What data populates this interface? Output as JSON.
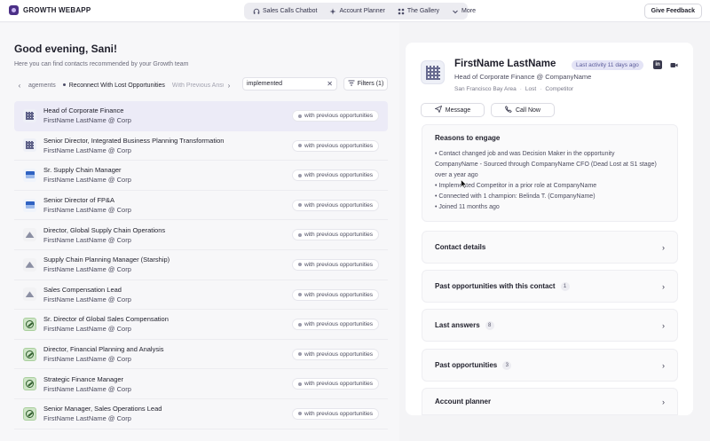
{
  "app": {
    "brand": "GROWTH WEBAPP"
  },
  "nav": {
    "items": [
      {
        "label": "Sales Calls Chatbot",
        "icon": "headset-icon"
      },
      {
        "label": "Account Planner",
        "icon": "sparkle-icon"
      },
      {
        "label": "The Gallery",
        "icon": "gallery-icon"
      },
      {
        "label": "More",
        "icon": "chevron-down-icon"
      }
    ],
    "feedback_label": "Give Feedback"
  },
  "left": {
    "greeting": "Good evening, Sani!",
    "subtitle": "Here you can find contacts recommended by your Growth team",
    "chips": [
      {
        "label": "agements"
      },
      {
        "label": "Reconnect With Lost Opportunities"
      },
      {
        "label": "With Previous Answ"
      }
    ],
    "search": {
      "value": "implemented"
    },
    "filters_label": "Filters (1)",
    "contacts": [
      {
        "title": "Head of Corporate Finance",
        "company": "FirstName LastName @ Corp",
        "tag": "with previous opportunities",
        "logo": "grid"
      },
      {
        "title": "Senior Director, Integrated Business Planning Transformation",
        "company": "FirstName LastName @ Corp",
        "tag": "with previous opportunities",
        "logo": "grid"
      },
      {
        "title": "Sr. Supply Chain Manager",
        "company": "FirstName LastName @ Corp",
        "tag": "with previous opportunities",
        "logo": "blue"
      },
      {
        "title": "Senior Director of FP&A",
        "company": "FirstName LastName @ Corp",
        "tag": "with previous opportunities",
        "logo": "blue"
      },
      {
        "title": "Director, Global Supply Chain Operations",
        "company": "FirstName LastName @ Corp",
        "tag": "with previous opportunities",
        "logo": "gray"
      },
      {
        "title": "Supply Chain Planning Manager (Starship)",
        "company": "FirstName LastName @ Corp",
        "tag": "with previous opportunities",
        "logo": "gray"
      },
      {
        "title": "Sales Compensation Lead",
        "company": "FirstName LastName @ Corp",
        "tag": "with previous opportunities",
        "logo": "gray"
      },
      {
        "title": "Sr. Director of Global Sales Compensation",
        "company": "FirstName LastName @ Corp",
        "tag": "with previous opportunities",
        "logo": "green"
      },
      {
        "title": "Director, Financial Planning and Analysis",
        "company": "FirstName LastName @ Corp",
        "tag": "with previous opportunities",
        "logo": "green"
      },
      {
        "title": "Strategic Finance Manager",
        "company": "FirstName LastName @ Corp",
        "tag": "with previous opportunities",
        "logo": "green"
      },
      {
        "title": "Senior Manager, Sales Operations Lead",
        "company": "FirstName LastName @ Corp",
        "tag": "with previous opportunities",
        "logo": "green"
      }
    ]
  },
  "detail": {
    "name": "FirstName LastName",
    "activity": "Last activity 11 days ago",
    "headline": "Head of Corporate Finance @ CompanyName",
    "location": "San Francisco Bay Area",
    "status": "Lost",
    "relation": "Competitor",
    "message_label": "Message",
    "call_label": "Call Now",
    "reasons_title": "Reasons to engage",
    "reasons": [
      "• Contact changed job and was Decision Maker in the opportunity",
      "CompanyName - Sourced through CompanyName CFO (Dead Lost at S1 stage)",
      "over a year ago",
      "• Implemented Competitor in a prior role at CompanyName",
      "• Connected with 1 champion: Belinda T. (CompanyName)",
      "• Joined 11 months ago"
    ],
    "sections": [
      {
        "title": "Contact details",
        "count": ""
      },
      {
        "title": "Past opportunities with this contact",
        "count": "1"
      },
      {
        "title": "Last answers",
        "count": "8"
      },
      {
        "title": "Past opportunities",
        "count": "3"
      },
      {
        "title": "Account planner",
        "count": ""
      }
    ]
  }
}
